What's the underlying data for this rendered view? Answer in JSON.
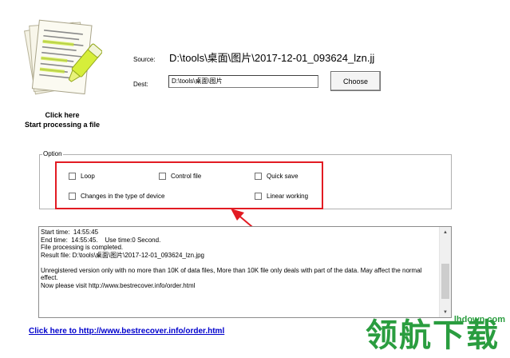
{
  "app": {
    "click_here": "Click here",
    "start_processing": "Start processing a file"
  },
  "source": {
    "label": "Source:",
    "value": "D:\\tools\\桌面\\图片\\2017-12-01_093624_lzn.jj"
  },
  "dest": {
    "label": "Dest:",
    "value": "D:\\tools\\桌面\\图片",
    "choose_label": "Choose"
  },
  "options": {
    "title": "Option",
    "loop": "Loop",
    "control_file": "Control file",
    "quick_save": "Quick save",
    "changes_device": "Changes in the type of device",
    "linear_working": "Linear working"
  },
  "log": {
    "text": "Start time:  14:55:45\nEnd time:  14:55:45.    Use time:0 Second.\nFile processing is completed.\nResult file: D:\\tools\\桌面\\图片\\2017-12-01_093624_lzn.jpg\n\nUnregistered version only with no more than 10K of data files, More than 10K file only deals with part of the data. May affect the normal effect.\nNow please visit http://www.bestrecover.info/order.html"
  },
  "footer": {
    "link": "Click here to http://www.bestrecover.info/order.html"
  },
  "watermark": {
    "big": "领航下载",
    "small": "lhdown.com"
  },
  "colors": {
    "highlight_red": "#e21b23",
    "link_blue": "#0000cc",
    "watermark_green": "#2a9d3f"
  },
  "icons": {
    "document": "document-pencil-icon"
  }
}
